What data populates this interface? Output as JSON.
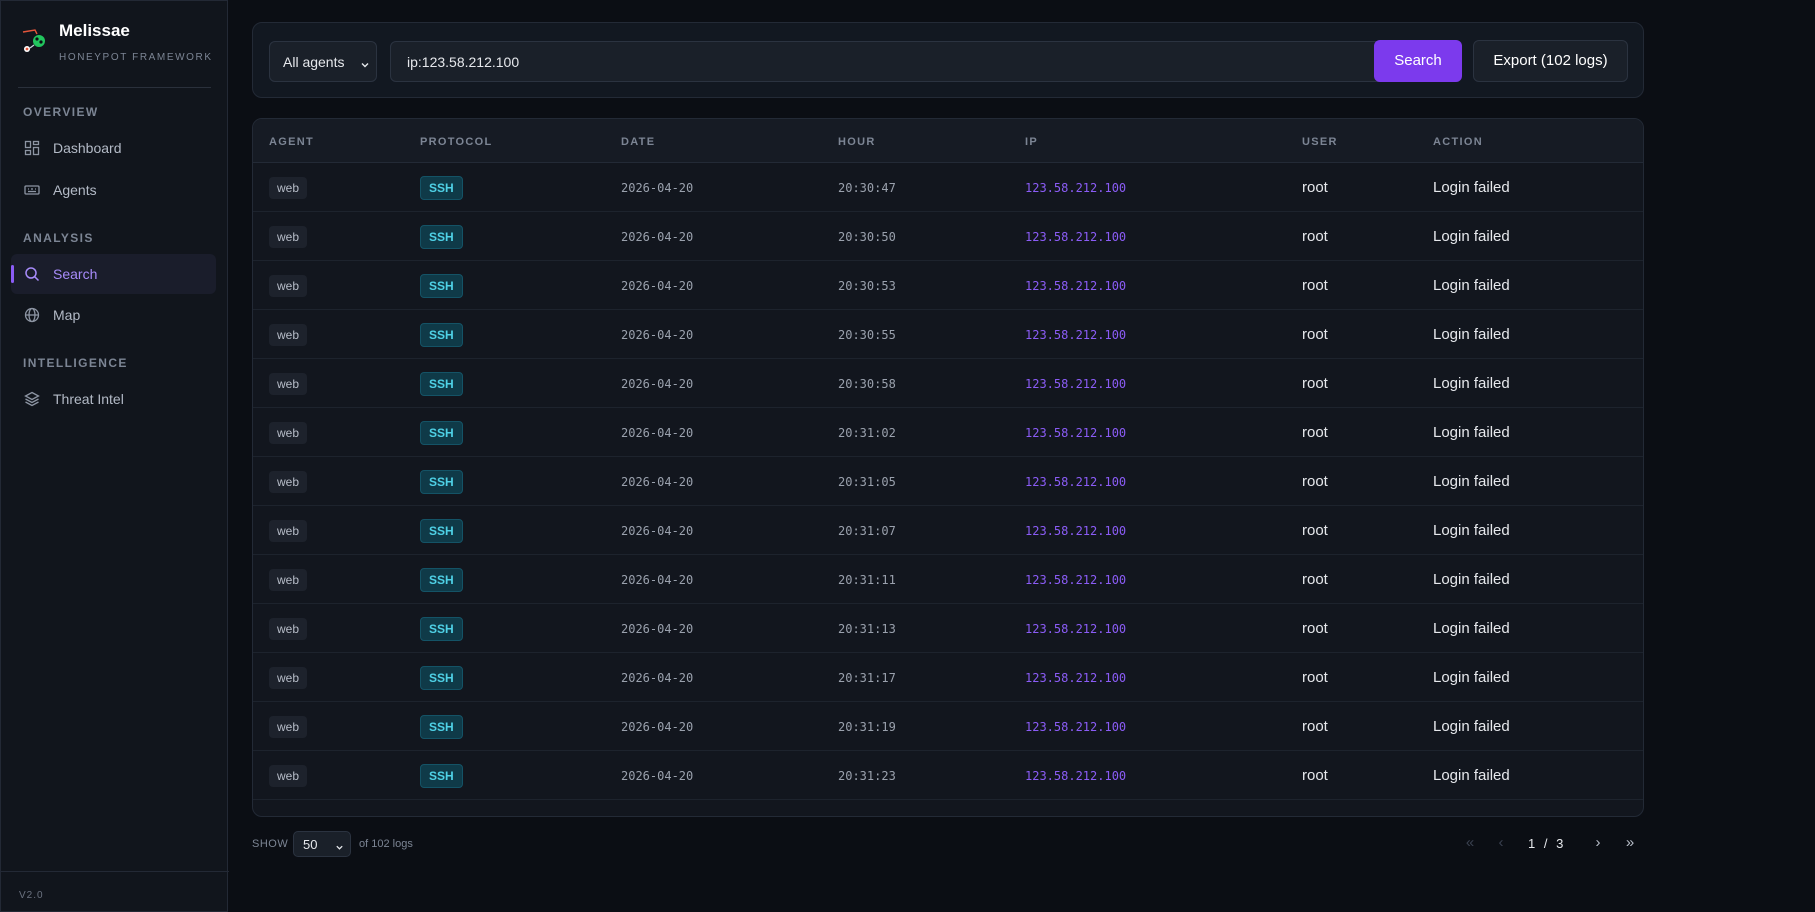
{
  "brand": {
    "title": "Melissae",
    "subtitle": "HONEYPOT FRAMEWORK"
  },
  "sidebar": {
    "sections": [
      {
        "label": "OVERVIEW",
        "items": [
          {
            "label": "Dashboard",
            "icon": "dashboard-grid-icon"
          },
          {
            "label": "Agents",
            "icon": "keyboard-icon"
          }
        ]
      },
      {
        "label": "ANALYSIS",
        "items": [
          {
            "label": "Search",
            "icon": "search-icon",
            "active": true
          },
          {
            "label": "Map",
            "icon": "globe-icon"
          }
        ]
      },
      {
        "label": "INTELLIGENCE",
        "items": [
          {
            "label": "Threat Intel",
            "icon": "layers-icon"
          }
        ]
      }
    ],
    "version": "V2.0"
  },
  "search": {
    "agent_select": "All agents",
    "query": "ip:123.58.212.100",
    "search_label": "Search",
    "export_label": "Export (102 logs)"
  },
  "table": {
    "columns": [
      "AGENT",
      "PROTOCOL",
      "DATE",
      "HOUR",
      "IP",
      "USER",
      "ACTION"
    ],
    "rows": [
      {
        "agent": "web",
        "protocol": "SSH",
        "date": "2026-04-20",
        "hour": "20:30:47",
        "ip": "123.58.212.100",
        "user": "root",
        "action": "Login failed"
      },
      {
        "agent": "web",
        "protocol": "SSH",
        "date": "2026-04-20",
        "hour": "20:30:50",
        "ip": "123.58.212.100",
        "user": "root",
        "action": "Login failed"
      },
      {
        "agent": "web",
        "protocol": "SSH",
        "date": "2026-04-20",
        "hour": "20:30:53",
        "ip": "123.58.212.100",
        "user": "root",
        "action": "Login failed"
      },
      {
        "agent": "web",
        "protocol": "SSH",
        "date": "2026-04-20",
        "hour": "20:30:55",
        "ip": "123.58.212.100",
        "user": "root",
        "action": "Login failed"
      },
      {
        "agent": "web",
        "protocol": "SSH",
        "date": "2026-04-20",
        "hour": "20:30:58",
        "ip": "123.58.212.100",
        "user": "root",
        "action": "Login failed"
      },
      {
        "agent": "web",
        "protocol": "SSH",
        "date": "2026-04-20",
        "hour": "20:31:02",
        "ip": "123.58.212.100",
        "user": "root",
        "action": "Login failed"
      },
      {
        "agent": "web",
        "protocol": "SSH",
        "date": "2026-04-20",
        "hour": "20:31:05",
        "ip": "123.58.212.100",
        "user": "root",
        "action": "Login failed"
      },
      {
        "agent": "web",
        "protocol": "SSH",
        "date": "2026-04-20",
        "hour": "20:31:07",
        "ip": "123.58.212.100",
        "user": "root",
        "action": "Login failed"
      },
      {
        "agent": "web",
        "protocol": "SSH",
        "date": "2026-04-20",
        "hour": "20:31:11",
        "ip": "123.58.212.100",
        "user": "root",
        "action": "Login failed"
      },
      {
        "agent": "web",
        "protocol": "SSH",
        "date": "2026-04-20",
        "hour": "20:31:13",
        "ip": "123.58.212.100",
        "user": "root",
        "action": "Login failed"
      },
      {
        "agent": "web",
        "protocol": "SSH",
        "date": "2026-04-20",
        "hour": "20:31:17",
        "ip": "123.58.212.100",
        "user": "root",
        "action": "Login failed"
      },
      {
        "agent": "web",
        "protocol": "SSH",
        "date": "2026-04-20",
        "hour": "20:31:19",
        "ip": "123.58.212.100",
        "user": "root",
        "action": "Login failed"
      },
      {
        "agent": "web",
        "protocol": "SSH",
        "date": "2026-04-20",
        "hour": "20:31:23",
        "ip": "123.58.212.100",
        "user": "root",
        "action": "Login failed"
      }
    ]
  },
  "pagination": {
    "show_label": "SHOW",
    "page_size": "50",
    "of_label": "of 102 logs",
    "current_page": "1",
    "total_pages": "3",
    "separator": "/"
  },
  "colors": {
    "accent": "#7c3aed",
    "ip": "#8b5cf6",
    "protocol": "#4fd1e6",
    "background": "#0b0e14"
  }
}
